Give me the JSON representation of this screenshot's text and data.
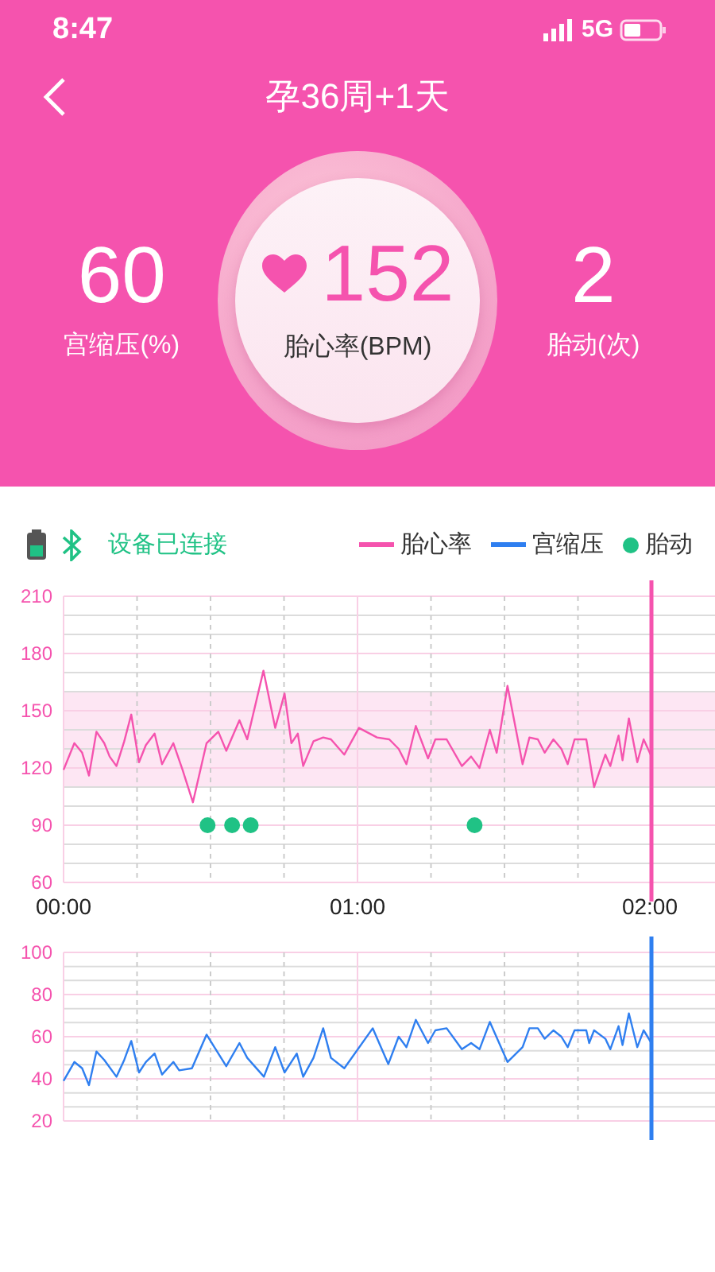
{
  "status_bar": {
    "time": "8:47",
    "network": "5G"
  },
  "header": {
    "title": "孕36周+1天"
  },
  "stats": [
    {
      "kind": "plain",
      "value": "60",
      "label": "宫缩压(%)"
    },
    {
      "kind": "featured",
      "value": "152",
      "label": "胎心率(BPM)"
    },
    {
      "kind": "plain",
      "value": "2",
      "label": "胎动(次)"
    }
  ],
  "device": {
    "status": "设备已连接",
    "connected": true
  },
  "charts": [
    {
      "chart_data": {
        "type": "line",
        "xlim": [
          0,
          120
        ],
        "ylim": [
          60,
          210
        ],
        "yticks": [
          60,
          90,
          120,
          150,
          180,
          210
        ],
        "xticks": [
          {
            "value": 0,
            "label": "00:00"
          },
          {
            "value": 60,
            "label": "01:00"
          },
          {
            "value": 120,
            "label": "02:00"
          }
        ],
        "grid": true,
        "bands": [
          {
            "axis": "y",
            "from": 110,
            "to": 160
          }
        ],
        "x": [
          0,
          2.2,
          3.8,
          5.2,
          6.7,
          8.3,
          9.4,
          10.8,
          12.4,
          13.8,
          15.4,
          16.8,
          18.6,
          20.1,
          22.4,
          24.3,
          26.4,
          29.2,
          31.6,
          33.2,
          35.9,
          37.5,
          40.8,
          43.2,
          45.1,
          46.5,
          47.8,
          48.9,
          51,
          53,
          54.6,
          57.3,
          60.3,
          64,
          66.5,
          68.4,
          70,
          71.9,
          74.4,
          75.9,
          78.2,
          81.3,
          83.2,
          84.9,
          87,
          88.4,
          90.6,
          93.7,
          95.1,
          96.8,
          98.2,
          100,
          101.6,
          102.9,
          104.3,
          106.7,
          108.3,
          110.6,
          111.6,
          113.3,
          114.1,
          115.4,
          117.1,
          118.4,
          120
        ],
        "series": [
          {
            "name": "胎心率",
            "color": "#f553ae",
            "values": [
              119,
              133,
              128,
              116,
              139,
              133,
              126,
              121,
              134,
              148,
              123,
              132,
              138,
              122,
              133,
              119,
              102,
              133,
              139,
              129,
              145,
              135,
              171,
              141,
              159,
              133,
              138,
              121,
              134,
              136,
              135,
              127,
              141,
              136,
              135,
              130,
              122,
              142,
              125,
              135,
              135,
              121,
              126,
              120,
              140,
              128,
              163,
              122,
              136,
              135,
              128,
              135,
              130,
              122,
              135,
              135,
              110,
              127,
              121,
              137,
              124,
              146,
              123,
              135,
              126
            ]
          },
          {
            "name": "胎动",
            "type": "scatter",
            "color": "#20c285",
            "x": [
              29.4,
              34.4,
              38.2,
              83.9
            ],
            "values": [
              90,
              90,
              90,
              90
            ]
          }
        ]
      }
    },
    {
      "chart_data": {
        "type": "line",
        "xlim": [
          0,
          120
        ],
        "ylim": [
          20,
          100
        ],
        "yticks": [
          20,
          40,
          60,
          80,
          100
        ],
        "grid": true,
        "x": [
          0,
          2.2,
          3.8,
          5.2,
          6.7,
          8.3,
          10.8,
          12.4,
          13.8,
          15.4,
          16.8,
          18.6,
          20.1,
          22.4,
          23.6,
          26.2,
          29.2,
          33.2,
          35.9,
          37.5,
          40.9,
          43.2,
          45.1,
          47.6,
          48.9,
          51,
          53,
          54.6,
          57.3,
          63.1,
          66.3,
          68.4,
          70,
          71.9,
          74.4,
          75.9,
          78.2,
          81.3,
          83.2,
          84.9,
          87,
          90.6,
          93.7,
          95.1,
          96.8,
          98.2,
          100,
          101.6,
          102.9,
          104.3,
          106.7,
          107.3,
          108.3,
          110.6,
          111.6,
          113.3,
          114.1,
          115.4,
          117.1,
          118.4,
          120
        ],
        "series": [
          {
            "name": "宫缩压",
            "color": "#2f7ff0",
            "values": [
              39,
              48,
              45,
              37,
              53,
              49,
              41,
              49,
              58,
              43,
              48,
              52,
              42,
              48,
              44,
              45,
              61,
              46,
              57,
              50,
              41,
              55,
              43,
              52,
              41,
              50,
              64,
              50,
              45,
              64,
              47,
              60,
              55,
              68,
              57,
              63,
              64,
              54,
              57,
              54,
              67,
              48,
              55,
              64,
              64,
              59,
              63,
              60,
              55,
              63,
              63,
              57,
              63,
              59,
              54,
              65,
              56,
              71,
              55,
              63,
              57
            ]
          }
        ]
      }
    }
  ]
}
